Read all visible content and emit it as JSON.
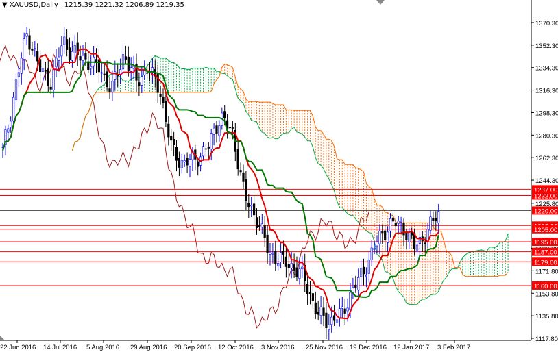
{
  "header": {
    "symbol": "XAUUSD,Daily",
    "ohlc": "1215.39 1221.32 1206.89 1219.35"
  },
  "colors": {
    "up": "#0000ff",
    "down": "#000000",
    "tenkan": "#e00000",
    "kijun": "#007700",
    "chikou": "#9b1b1b",
    "cloud_bear": "#ff6a00",
    "cloud_bull": "#00aa44",
    "level": "#ff0000"
  },
  "chart_data": {
    "type": "candlestick",
    "title": "XAUUSD,Daily",
    "indicator": "Ichimoku Kinko Hyo",
    "ylim": [
      1117.8,
      1380
    ],
    "y_ticks": [
      "1370.30",
      "1352.30",
      "1334.30",
      "1316.30",
      "1298.30",
      "1280.30",
      "1262.30",
      "1244.30",
      "1225.80",
      "1189.80",
      "1171.80",
      "1153.80",
      "1135.80",
      "1117.80"
    ],
    "x_ticks": [
      "22 Jun 2016",
      "14 Jul 2016",
      "5 Aug 2016",
      "29 Aug 2016",
      "20 Sep 2016",
      "12 Oct 2016",
      "3 Nov 2016",
      "25 Nov 2016",
      "19 Dec 2016",
      "12 Jan 2017",
      "3 Feb 2017"
    ],
    "approx_closes": [
      1268,
      1290,
      1317,
      1340,
      1361,
      1350,
      1334,
      1328,
      1323,
      1340,
      1356,
      1348,
      1345,
      1342,
      1340,
      1336,
      1334,
      1325,
      1317,
      1330,
      1345,
      1335,
      1323,
      1328,
      1334,
      1325,
      1317,
      1290,
      1268,
      1262,
      1257,
      1260,
      1262,
      1266,
      1271,
      1285,
      1295,
      1288,
      1282,
      1257,
      1230,
      1222,
      1213,
      1200,
      1186,
      1183,
      1180,
      1178,
      1175,
      1170,
      1164,
      1150,
      1137,
      1134,
      1131,
      1134,
      1137,
      1148,
      1158,
      1166,
      1175,
      1186,
      1197,
      1203,
      1208,
      1210,
      1208,
      1200,
      1191,
      1196,
      1202,
      1210,
      1219.35
    ],
    "levels": [
      {
        "label": "1237.00",
        "value": 1237
      },
      {
        "label": "1232.00",
        "value": 1232
      },
      {
        "label": "1220.00",
        "value": 1220
      },
      {
        "label": "1208.00",
        "value": 1208
      },
      {
        "label": "1205.00",
        "value": 1205
      },
      {
        "label": "1195.00",
        "value": 1195
      },
      {
        "label": "1187.00",
        "value": 1187
      },
      {
        "label": "1179.00",
        "value": 1179
      },
      {
        "label": "1160.00",
        "value": 1160
      }
    ]
  }
}
